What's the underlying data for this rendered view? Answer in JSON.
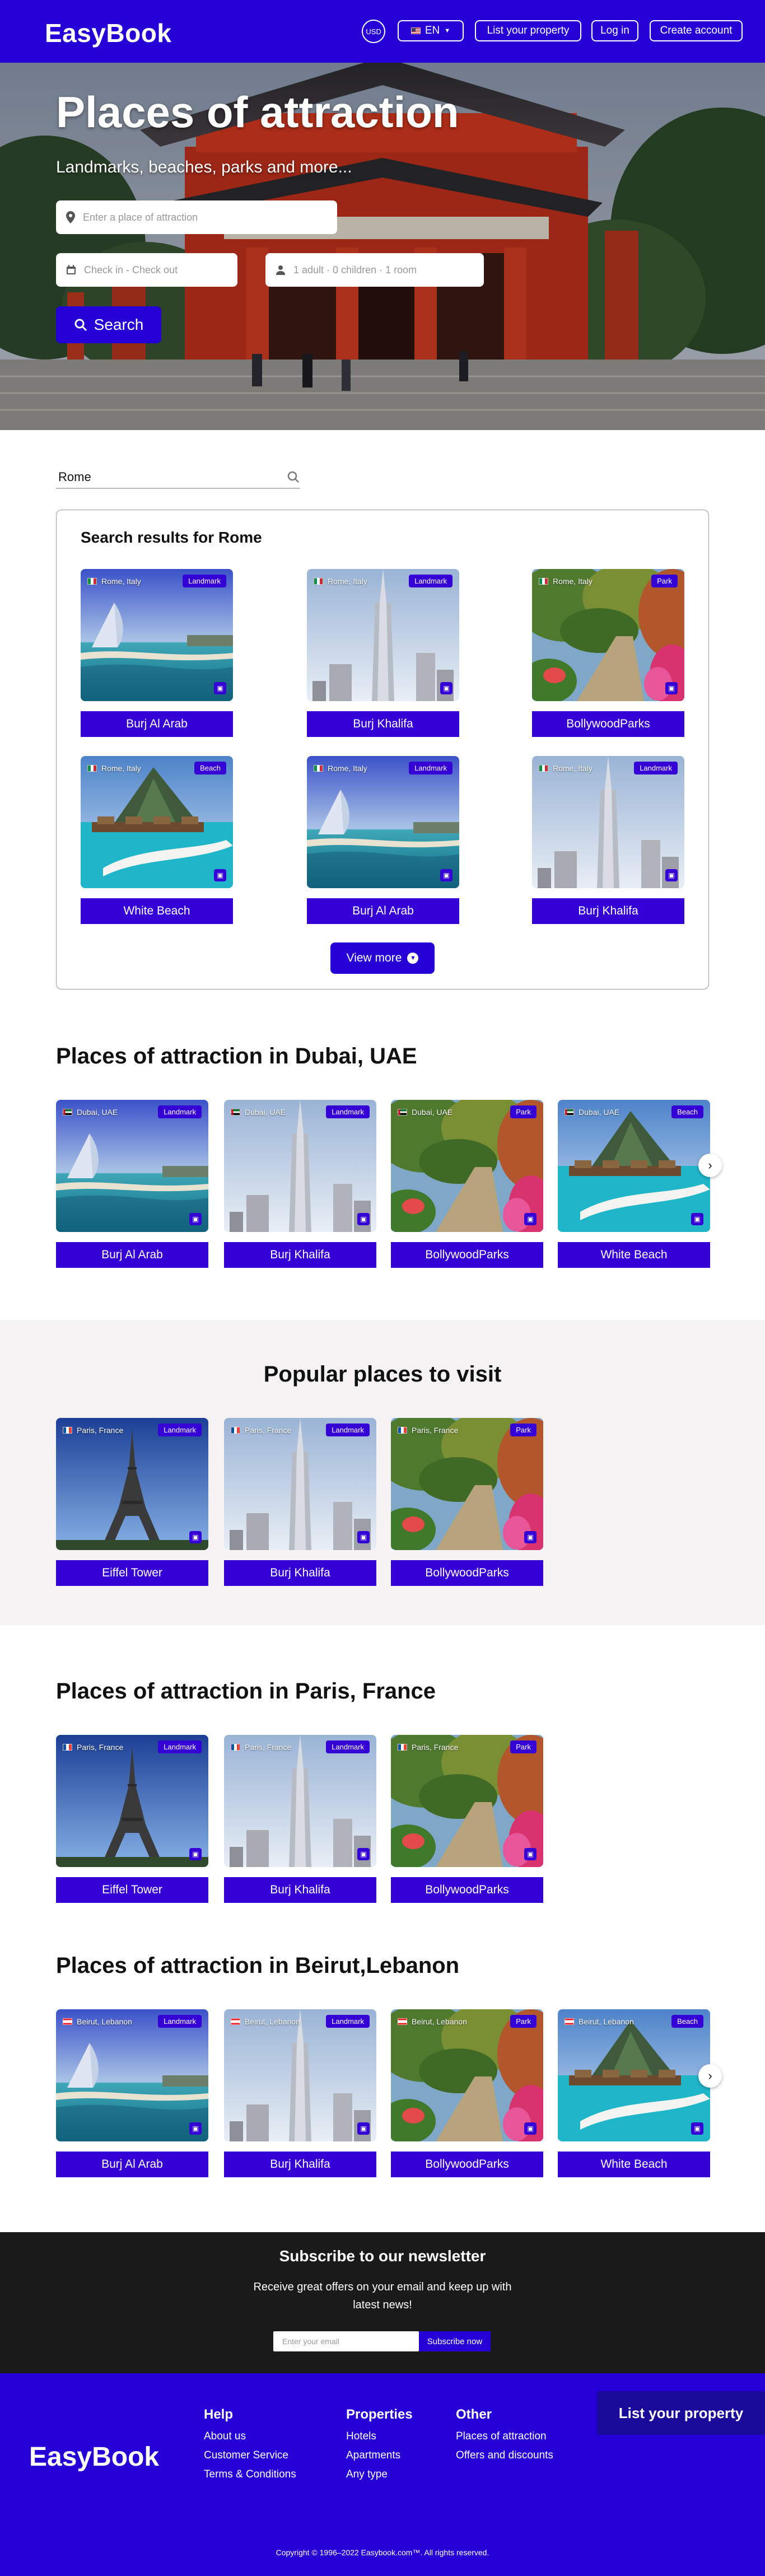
{
  "header": {
    "logo": "EasyBook",
    "currency": "USD",
    "language": "EN",
    "list_property": "List your property",
    "login": "Log in",
    "create_account": "Create account"
  },
  "hero": {
    "title": "Places of attraction",
    "subtitle": "Landmarks, beaches, parks and more...",
    "place_placeholder": "Enter a place of attraction",
    "dates_placeholder": "Check in - Check out",
    "guests_placeholder": "1 adult · 0 children · 1 room",
    "search_label": "Search"
  },
  "inline_search": {
    "value": "Rome"
  },
  "results": {
    "title": "Search results for Rome",
    "view_more": "View more",
    "cards": [
      {
        "location": "Rome, Italy",
        "badge": "Landmark",
        "name": "Burj Al Arab",
        "image": "beach-hotel"
      },
      {
        "location": "Rome, Italy",
        "badge": "Landmark",
        "name": "Burj Khalifa",
        "image": "tower"
      },
      {
        "location": "Rome, Italy",
        "badge": "Park",
        "name": "BollywoodParks",
        "image": "park"
      },
      {
        "location": "Rome, Italy",
        "badge": "Beach",
        "name": "White Beach",
        "image": "island"
      },
      {
        "location": "Rome, Italy",
        "badge": "Landmark",
        "name": "Burj Al Arab",
        "image": "beach-hotel"
      },
      {
        "location": "Rome, Italy",
        "badge": "Landmark",
        "name": "Burj Khalifa",
        "image": "tower"
      }
    ]
  },
  "dubai": {
    "title": "Places of attraction in Dubai, UAE",
    "cards": [
      {
        "location": "Dubai, UAE",
        "badge": "Landmark",
        "name": "Burj Al Arab",
        "image": "beach-hotel"
      },
      {
        "location": "Dubai, UAE",
        "badge": "Landmark",
        "name": "Burj Khalifa",
        "image": "tower"
      },
      {
        "location": "Dubai, UAE",
        "badge": "Park",
        "name": "BollywoodParks",
        "image": "park"
      },
      {
        "location": "Dubai, UAE",
        "badge": "Beach",
        "name": "White Beach",
        "image": "island"
      }
    ]
  },
  "popular": {
    "title": "Popular places to visit",
    "cards": [
      {
        "location": "Paris, France",
        "badge": "Landmark",
        "name": "Eiffel Tower",
        "image": "eiffel"
      },
      {
        "location": "Paris, France",
        "badge": "Landmark",
        "name": "Burj Khalifa",
        "image": "tower"
      },
      {
        "location": "Paris, France",
        "badge": "Park",
        "name": "BollywoodParks",
        "image": "park"
      }
    ]
  },
  "paris": {
    "title": "Places of attraction in Paris, France",
    "cards": [
      {
        "location": "Paris, France",
        "badge": "Landmark",
        "name": "Eiffel Tower",
        "image": "eiffel"
      },
      {
        "location": "Paris, France",
        "badge": "Landmark",
        "name": "Burj Khalifa",
        "image": "tower"
      },
      {
        "location": "Paris, France",
        "badge": "Park",
        "name": "BollywoodParks",
        "image": "park"
      }
    ]
  },
  "beirut": {
    "title": "Places of attraction in Beirut,Lebanon",
    "cards": [
      {
        "location": "Beirut, Lebanon",
        "badge": "Landmark",
        "name": "Burj Al Arab",
        "image": "beach-hotel"
      },
      {
        "location": "Beirut, Lebanon",
        "badge": "Landmark",
        "name": "Burj Khalifa",
        "image": "tower"
      },
      {
        "location": "Beirut, Lebanon",
        "badge": "Park",
        "name": "BollywoodParks",
        "image": "park"
      },
      {
        "location": "Beirut, Lebanon",
        "badge": "Beach",
        "name": "White Beach",
        "image": "island"
      }
    ]
  },
  "newsletter": {
    "title": "Subscribe to our newsletter",
    "text": "Receive great offers on your email and keep up with latest news!",
    "email_placeholder": "Enter your email",
    "subscribe": "Subscribe now"
  },
  "footer": {
    "logo": "EasyBook",
    "help": {
      "title": "Help",
      "links": [
        "About us",
        "Customer Service",
        "Terms & Conditions"
      ]
    },
    "properties": {
      "title": "Properties",
      "links": [
        "Hotels",
        "Apartments",
        "Any type"
      ]
    },
    "other": {
      "title": "Other",
      "links": [
        "Places of attraction",
        "Offers and discounts"
      ]
    },
    "list_property": "List your property",
    "copyright": "Copyright © 1996–2022 Easybook.com™. All rights reserved."
  },
  "colors": {
    "brand": "#2500d6",
    "card_button": "#3500d6",
    "newsletter_bg": "#1a1a1a",
    "popular_bg": "#f4f2f2"
  }
}
